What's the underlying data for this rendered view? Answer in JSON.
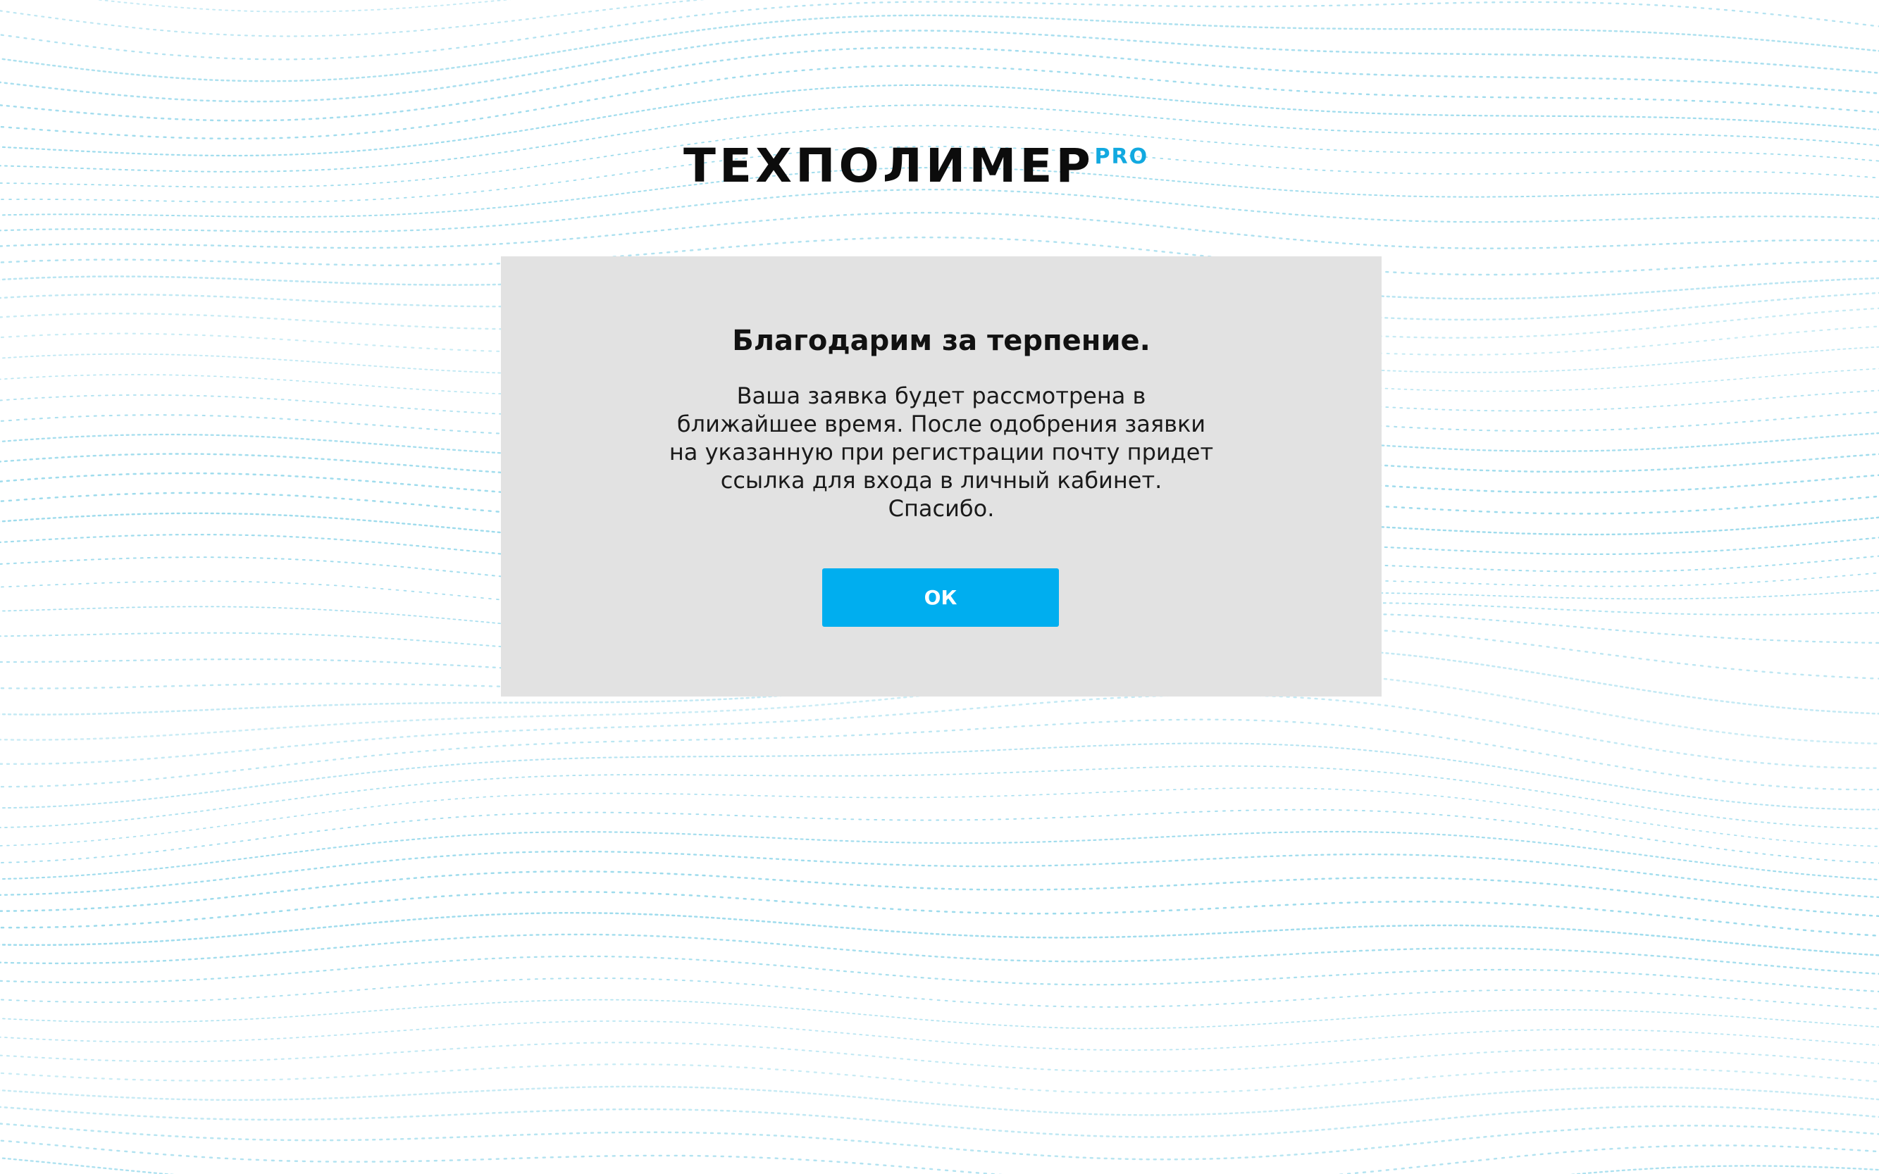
{
  "logo": {
    "main": "ТЕХПОЛИМЕР",
    "suffix": "PRO",
    "main_color": "#0c0c0c",
    "suffix_color": "#12a9e0"
  },
  "background": {
    "pattern": "dotted-waves",
    "dot_color": "#5cc3e0"
  },
  "dialog": {
    "background_color": "#e2e2e2",
    "title": "Благодарим за терпение.",
    "message_lines": [
      "Ваша заявка будет рассмотрена в",
      "ближайшее время. После одобрения заявки",
      "на указанную при регистрации почту придет",
      "ссылка для входа в личный кабинет.",
      "Спасибо."
    ],
    "ok_label": "ОК",
    "accent_color": "#00aeef"
  }
}
